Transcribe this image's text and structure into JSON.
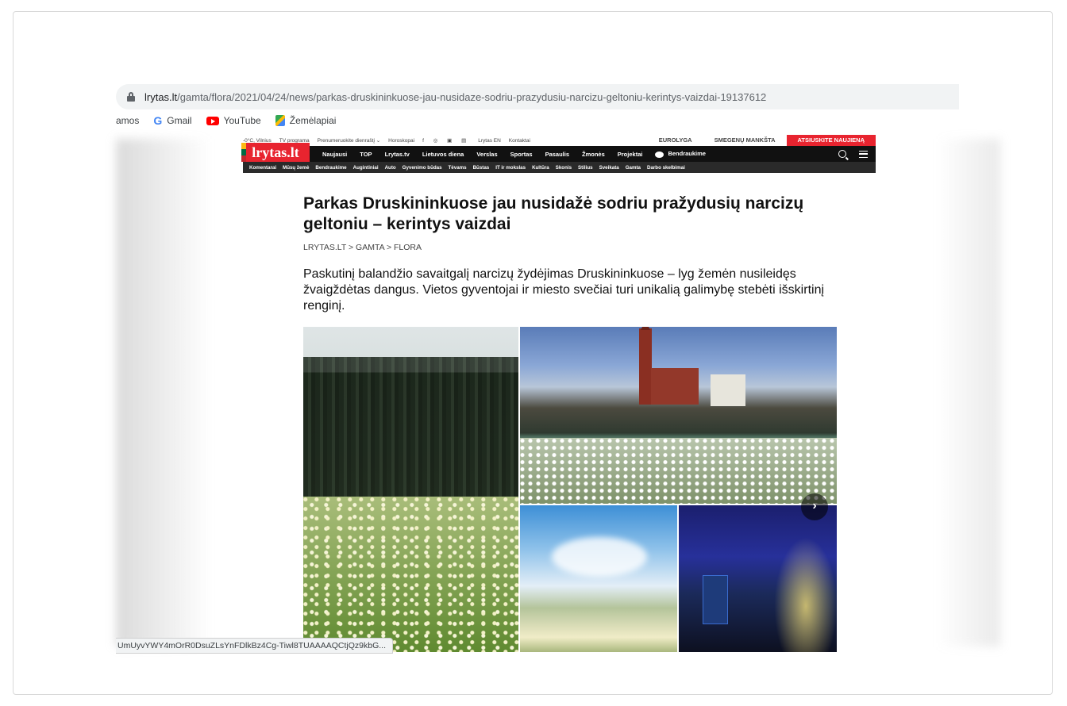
{
  "browser": {
    "url_host": "lrytas.lt",
    "url_path": "/gamta/flora/2021/04/24/news/parkas-druskininkuose-jau-nusidaze-sodriu-prazydusiu-narcizu-geltoniu-kerintys-vaizdai-19137612",
    "bookmarks": [
      {
        "label": "amos",
        "icon": "none"
      },
      {
        "label": "Gmail",
        "icon": "google-icon"
      },
      {
        "label": "YouTube",
        "icon": "youtube-icon"
      },
      {
        "label": "Žemėlapiai",
        "icon": "maps-icon"
      }
    ],
    "status_url": "UmUyvYWY4mOrR0DsuZLsYnFDlkBz4Cg-Tiwl8TUAAAAQCtjQz9kbG..."
  },
  "site": {
    "logo": "lrytas.lt",
    "topbar": {
      "items": [
        "-0°C, Vilnius",
        "TV programa",
        "Prenumeruokite dienraštį ⌄",
        "Horoskopai",
        "f ◎ ▣ ▤",
        "Lrytas EN",
        "Kontaktai"
      ],
      "buttons": [
        "EUROLYGA",
        "SMEGENŲ MANKŠTA",
        "ATSIUSKITE NAUJIENĄ"
      ]
    },
    "nav": [
      "Naujausi",
      "TOP",
      "Lrytas.tv",
      "Lietuvos diena",
      "Verslas",
      "Sportas",
      "Pasaulis",
      "Žmonės",
      "Projektai",
      "Bendraukime"
    ],
    "subnav": [
      "Komentarai",
      "Mūsų žemė",
      "Bendraukime",
      "Augintiniai",
      "Auto",
      "Gyvenimo būdas",
      "Tėvams",
      "Būstas",
      "IT ir mokslas",
      "Kultūra",
      "Skonis",
      "Stilius",
      "Sveikata",
      "Gamta",
      "Darbo skelbimai"
    ]
  },
  "article": {
    "title": "Parkas Druskininkuose jau nusidažė sodriu pražydusių narcizų geltoniu – kerintys vaizdai",
    "breadcrumb": "LRYTAS.LT > GAMTA > FLORA",
    "lead": "Paskutinį balandžio savaitgalį narcizų žydėjimas Druskininkuose – lyg žemėn nusileidęs žvaigždėtas dangus. Vietos gyventojai ir miesto svečiai turi unikalią galimybę stebėti išskirtinį renginį.",
    "next_glyph": "›"
  }
}
